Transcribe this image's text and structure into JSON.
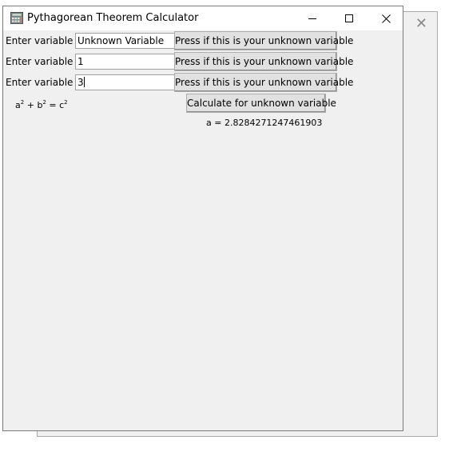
{
  "background_window": {
    "close_glyph": "✕"
  },
  "window": {
    "title": "Pythagorean Theorem Calculator",
    "controls": {
      "minimize": "—",
      "maximize": "☐",
      "close": "✕"
    },
    "app_icon": "calculator-icon"
  },
  "form": {
    "rows": [
      {
        "label": "Enter variable a:",
        "value": "Unknown Variable",
        "button": "Press if this is your unknown variable"
      },
      {
        "label": "Enter variable b:",
        "value": "1",
        "button": "Press if this is your unknown variable"
      },
      {
        "label": "Enter variable c:",
        "value": "3",
        "button": "Press if this is your unknown variable"
      }
    ],
    "formula": {
      "a": "a",
      "plus": "+",
      "b": "b",
      "eq": "=",
      "c": "c",
      "exp": "2"
    },
    "calculate_label": "Calculate for unknown variable",
    "result": "a = 2.8284271247461903"
  }
}
